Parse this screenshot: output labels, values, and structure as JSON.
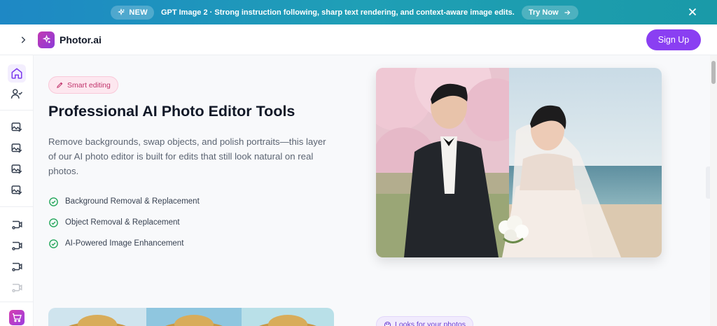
{
  "banner": {
    "badge": "NEW",
    "text": "GPT Image 2 · Strong instruction following, sharp text rendering, and context-aware image edits.",
    "cta": "Try Now"
  },
  "header": {
    "brand": "Photor.ai",
    "signup": "Sign Up"
  },
  "hero": {
    "tag": "Smart editing",
    "title": "Professional AI Photo Editor Tools",
    "description": "Remove backgrounds, swap objects, and polish portraits—this layer of our AI photo editor is built for edits that still look natural on real photos.",
    "features": [
      "Background Removal & Replacement",
      "Object Removal & Replacement",
      "AI-Powered Image Enhancement"
    ]
  },
  "next_section": {
    "tag": "Looks for your photos"
  },
  "colors": {
    "accent": "#8a3ff2",
    "check": "#22a65a",
    "tag_pink": "#c0336b"
  }
}
